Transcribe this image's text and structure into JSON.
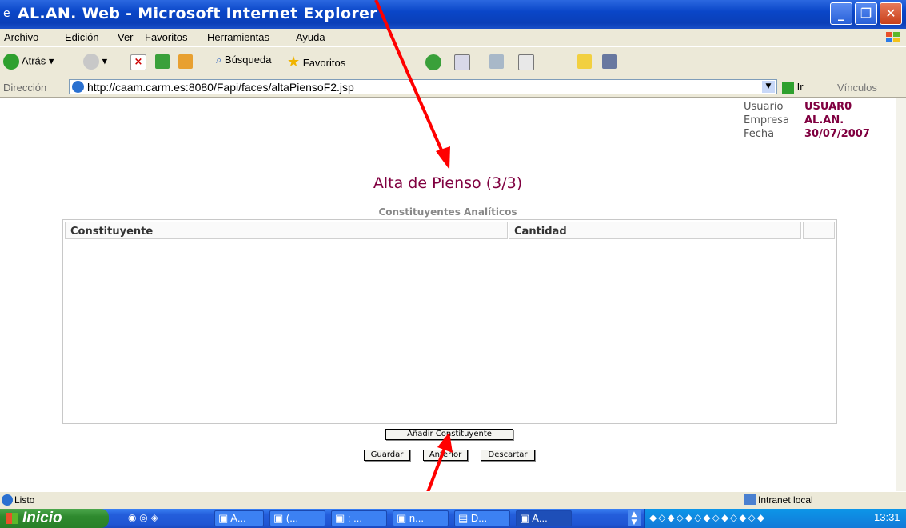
{
  "window": {
    "title": "AL.AN. Web - Microsoft Internet Explorer"
  },
  "menu": [
    "Archivo",
    "Edición",
    "Ver",
    "Favoritos",
    "Herramientas",
    "Ayuda"
  ],
  "toolbar": {
    "back": "Atrás",
    "search": "Búsqueda",
    "favorites": "Favoritos"
  },
  "address": {
    "label": "Dirección",
    "url": "http://caam.carm.es:8080/Fapi/faces/altaPiensoF2.jsp",
    "go": "Ir",
    "links": "Vínculos"
  },
  "user_info": {
    "user_label": "Usuario",
    "user_value": "USUAR0",
    "company_label": "Empresa",
    "company_value": "AL.AN.",
    "date_label": "Fecha",
    "date_value": "30/07/2007"
  },
  "page": {
    "title": "Alta de Pienso (3/3)",
    "table_caption": "Constituyentes Analíticos",
    "columns": [
      "Constituyente",
      "Cantidad"
    ],
    "add_button": "Añadir Constituyente",
    "save_button": "Guardar",
    "previous_button": "Anterior",
    "discard_button": "Descartar"
  },
  "status": {
    "text": "Listo",
    "zone": "Intranet local"
  },
  "taskbar": {
    "start": "Inicio",
    "tasks": [
      "A...",
      "(...",
      ": ...",
      "n...",
      "D...",
      "A..."
    ],
    "clock": "13:31"
  },
  "colors": {
    "accent": "#800040",
    "xp_blue": "#0a46c8"
  }
}
